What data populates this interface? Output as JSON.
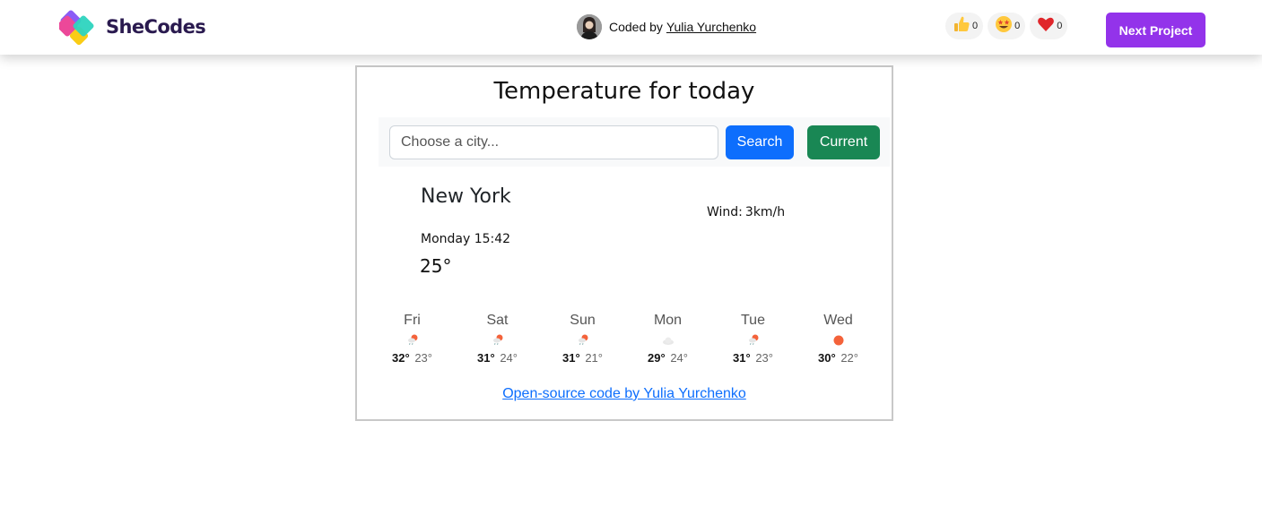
{
  "nav": {
    "brand": "SheCodes",
    "coded_by_prefix": "Coded by",
    "coder_name": "Yulia Yurchenko",
    "reactions": [
      {
        "icon": "thumbs-up-icon",
        "count": "0"
      },
      {
        "icon": "star-struck-icon",
        "count": "0"
      },
      {
        "icon": "heart-icon",
        "count": "0"
      }
    ],
    "next_label": "Next Project",
    "next_color": "#9333ea"
  },
  "app": {
    "title": "Temperature for today",
    "search": {
      "placeholder": "Choose a city...",
      "value": "",
      "search_label": "Search",
      "current_label": "Current"
    },
    "colors": {
      "search": "#0d6efd",
      "current": "#198754"
    },
    "city": "New York",
    "datetime": "Monday 15:42",
    "temperature": "25°",
    "wind_label": "Wind:",
    "wind_value": "3km/h",
    "forecast": [
      {
        "day": "Fri",
        "icon": "sun-rain-icon",
        "max": "32°",
        "min": "23°"
      },
      {
        "day": "Sat",
        "icon": "sun-rain-icon",
        "max": "31°",
        "min": "24°"
      },
      {
        "day": "Sun",
        "icon": "sun-rain-icon",
        "max": "31°",
        "min": "21°"
      },
      {
        "day": "Mon",
        "icon": "cloud-icon",
        "max": "29°",
        "min": "24°"
      },
      {
        "day": "Tue",
        "icon": "sun-rain-icon",
        "max": "31°",
        "min": "23°"
      },
      {
        "day": "Wed",
        "icon": "sun-icon",
        "max": "30°",
        "min": "22°"
      }
    ],
    "footer_link": "Open-source code by Yulia Yurchenko"
  }
}
